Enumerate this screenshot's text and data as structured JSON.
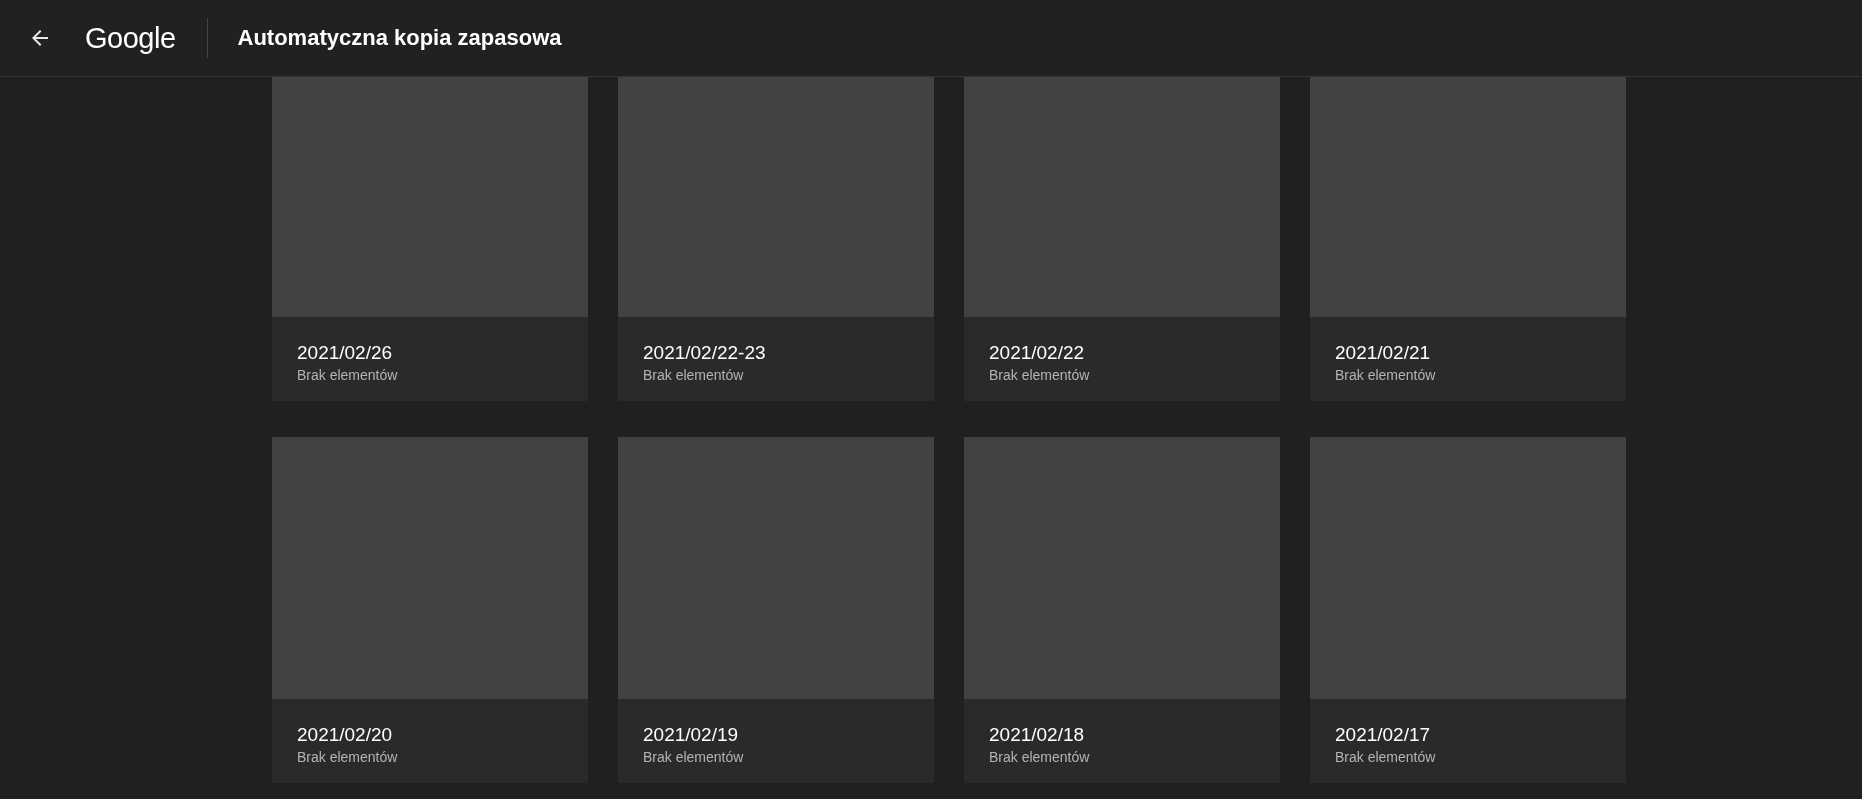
{
  "header": {
    "logo": "Google",
    "title": "Automatyczna kopia zapasowa"
  },
  "albums": [
    {
      "date": "2021/02/26",
      "subtitle": "Brak elementów"
    },
    {
      "date": "2021/02/22-23",
      "subtitle": "Brak elementów"
    },
    {
      "date": "2021/02/22",
      "subtitle": "Brak elementów"
    },
    {
      "date": "2021/02/21",
      "subtitle": "Brak elementów"
    },
    {
      "date": "2021/02/20",
      "subtitle": "Brak elementów"
    },
    {
      "date": "2021/02/19",
      "subtitle": "Brak elementów"
    },
    {
      "date": "2021/02/18",
      "subtitle": "Brak elementów"
    },
    {
      "date": "2021/02/17",
      "subtitle": "Brak elementów"
    }
  ]
}
